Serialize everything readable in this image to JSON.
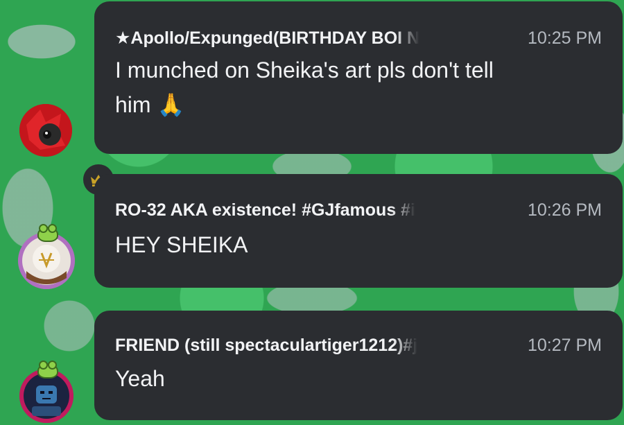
{
  "messages": [
    {
      "author": "★Apollo/Expunged(BIRTHDAY BOI N",
      "time": "10:25 PM",
      "text": "I munched on Sheika's art pls don't tell",
      "text2": "him 🙏",
      "avatar": "red-robot-avatar"
    },
    {
      "author": "RO-32 AKA existence!  #GJfamous #i",
      "time": "10:26 PM",
      "text": "HEY SHEIKA",
      "avatar": "white-mask-avatar",
      "badge": "crown-icon"
    },
    {
      "author": "FRIEND (still spectaculartiger1212)#j",
      "time": "10:27 PM",
      "text": "Yeah",
      "avatar": "blue-robot-avatar"
    }
  ],
  "colors": {
    "bubble": "#2b2d31",
    "text": "#f2f3f5",
    "time": "#b5bac1",
    "background": "#2fa552",
    "crown": "#c9a227"
  }
}
